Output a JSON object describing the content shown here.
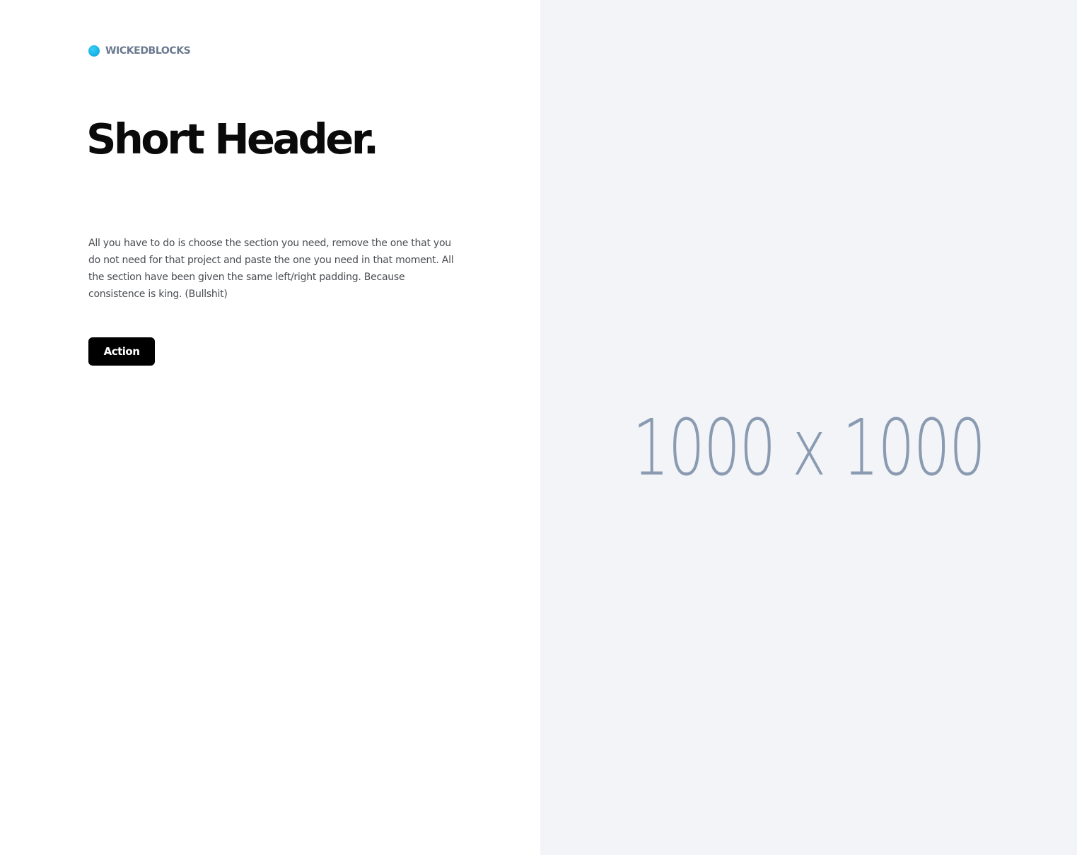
{
  "brand": {
    "name": "WICKEDBLOCKS",
    "icon": "blue-dot-logo",
    "dot_color": "#1bb5ea"
  },
  "hero": {
    "headline": "Short Header.",
    "body": "All you have to do is choose the section you need, remove the one that you do not need for that project and paste the one you need in that moment. All the section have been given the same left/right padding. Because consistence is king. (Bullshit)",
    "action_label": "Action"
  },
  "image_placeholder": {
    "label": "1000 x 1000",
    "background": "#f2f4f7",
    "text_color": "#8a9ab1"
  }
}
